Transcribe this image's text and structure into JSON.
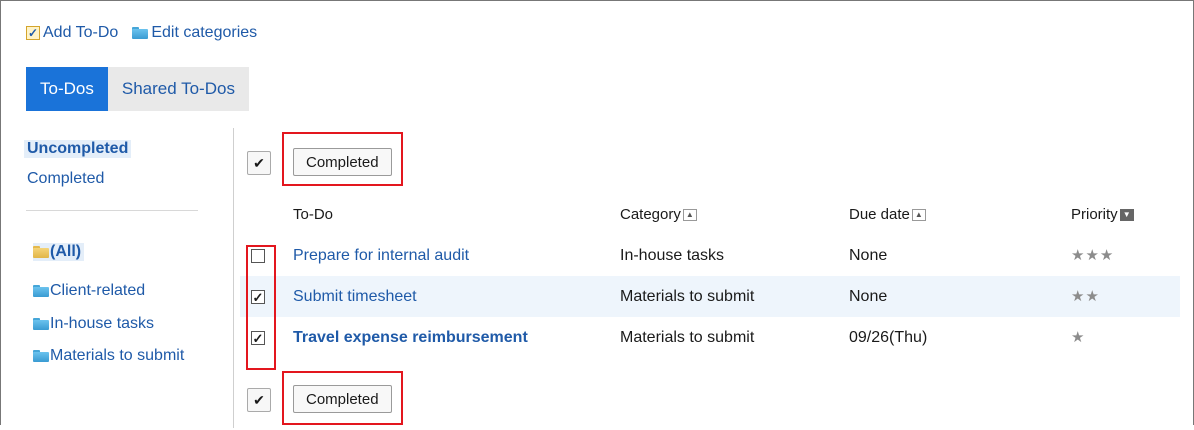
{
  "toolbar": {
    "add_todo": "Add To-Do",
    "edit_categories": "Edit categories"
  },
  "tabs": [
    {
      "label": "To-Dos",
      "active": true
    },
    {
      "label": "Shared To-Dos",
      "active": false
    }
  ],
  "sidebar": {
    "statuses": [
      {
        "label": "Uncompleted",
        "current": true
      },
      {
        "label": "Completed",
        "current": false
      }
    ],
    "categories": [
      {
        "label": "(All)",
        "current": true
      },
      {
        "label": "Client-related",
        "current": false
      },
      {
        "label": "In-house tasks",
        "current": false
      },
      {
        "label": "Materials to submit",
        "current": false
      }
    ]
  },
  "actions": {
    "check_all_glyph": "✔",
    "completed_label": "Completed"
  },
  "table": {
    "columns": [
      "To-Do",
      "Category",
      "Due date",
      "Priority"
    ],
    "rows": [
      {
        "checked": false,
        "title": "Prepare for internal audit",
        "category": "In-house tasks",
        "due": "None",
        "priority": "★★★",
        "bold": false
      },
      {
        "checked": true,
        "title": "Submit timesheet",
        "category": "Materials to submit",
        "due": "None",
        "priority": "★★",
        "bold": false
      },
      {
        "checked": true,
        "title": "Travel expense reimbursement",
        "category": "Materials to submit",
        "due": "09/26(Thu)",
        "priority": "★",
        "bold": true
      }
    ]
  },
  "colors": {
    "accent": "#1a73d9",
    "link": "#1f5aa8",
    "highlight": "#e3161e",
    "row_alt": "#eef5fc"
  }
}
